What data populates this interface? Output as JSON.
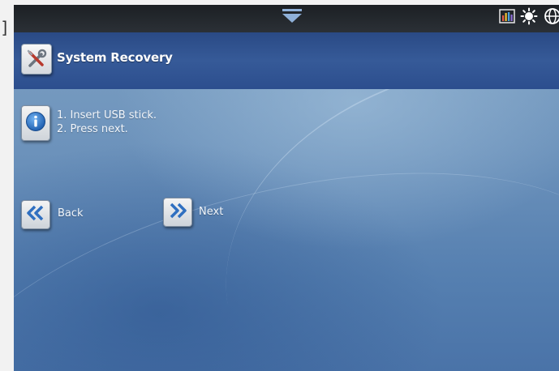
{
  "edge_glyph": "]",
  "status_bar": {
    "pulldown_icon": "chevron-down-icon",
    "icons": [
      "bar-chart-icon",
      "brightness-icon",
      "globe-icon"
    ]
  },
  "header": {
    "icon": "tools-icon",
    "title": "System Recovery"
  },
  "instructions": {
    "icon": "info-icon",
    "lines": [
      "1. Insert USB stick.",
      "2. Press next."
    ]
  },
  "navigation": {
    "back_label": "Back",
    "next_label": "Next"
  },
  "colors": {
    "header_bar": "#2e5190",
    "status_bar": "#1c2024",
    "accent_blue": "#2f6fc0"
  }
}
